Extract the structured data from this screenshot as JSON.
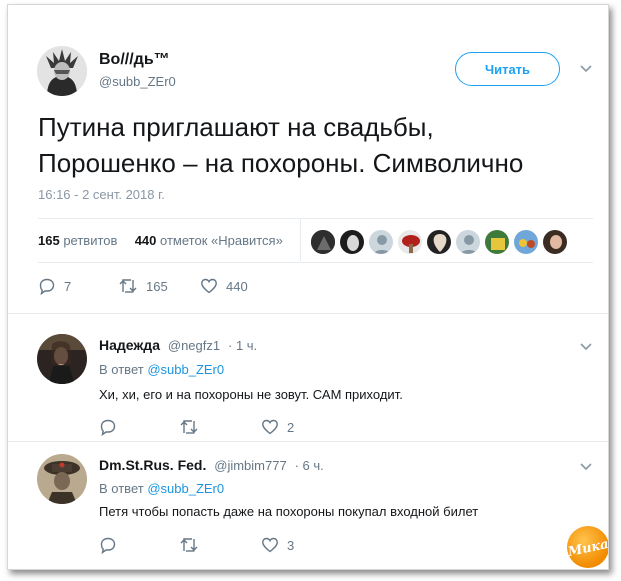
{
  "tweet": {
    "author_name": "Во///дь™",
    "author_handle": "@subb_ZEr0",
    "follow_label": "Читать",
    "text": "Путина приглашают на свадьбы,\nПорошенко – на похороны. Символично",
    "timestamp": "16:16 - 2 сент. 2018 г.",
    "retweets_count": "165",
    "retweets_label": "ретвитов",
    "likes_count": "440",
    "likes_label": "отметок «Нравится»",
    "actions": {
      "replies": "7",
      "retweets": "165",
      "likes": "440"
    }
  },
  "replies": [
    {
      "name": "Надежда",
      "handle": "@negfz1",
      "time": "· 1 ч.",
      "in_reply_prefix": "В ответ",
      "in_reply_handle": "@subb_ZEr0",
      "text": "Хи, хи, его и на похороны не зовут. САМ приходит.",
      "likes": "2"
    },
    {
      "name": "Dm.St.Rus. Fed.",
      "handle": "@jimbim777",
      "time": "· 6 ч.",
      "in_reply_prefix": "В ответ",
      "in_reply_handle": "@subb_ZEr0",
      "text": "Петя чтобы попасть даже на похороны покупал входной билет",
      "likes": "3"
    }
  ],
  "watermark": "Мика",
  "colors": {
    "accent": "#1da1f2",
    "link": "#1b95e0",
    "muted": "#657786",
    "text": "#14171a"
  }
}
